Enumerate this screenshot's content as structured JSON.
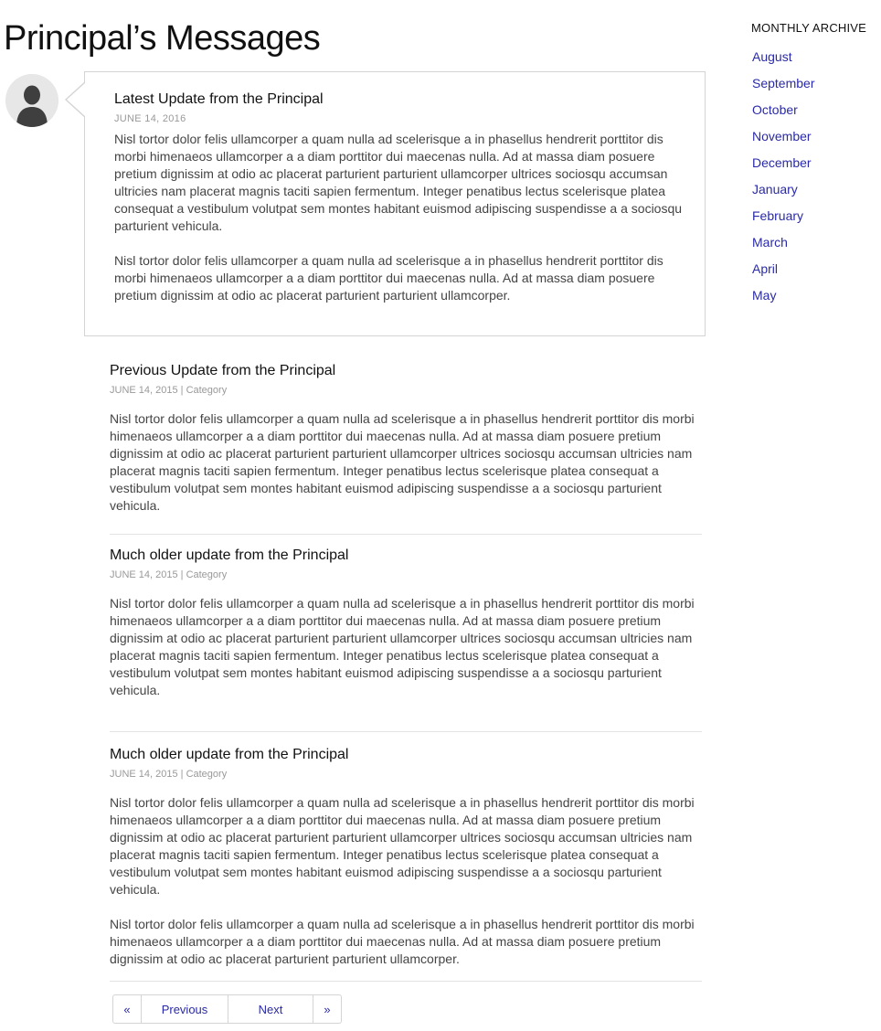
{
  "page": {
    "title": "Principal’s Messages"
  },
  "featured": {
    "title": "Latest Update from the Principal",
    "date": "JUNE 14, 2016",
    "paragraphs": [
      "Nisl tortor dolor felis ullamcorper a quam nulla ad scelerisque a in phasellus hendrerit porttitor dis morbi himenaeos ullamcorper a a diam porttitor dui maecenas nulla. Ad at massa diam posuere pretium dignissim at odio ac placerat parturient parturient ullamcorper ultrices sociosqu accumsan ultricies nam placerat magnis taciti sapien fermentum. Integer penatibus lectus scelerisque platea consequat a vestibulum volutpat sem montes habitant euismod adipiscing suspendisse a a sociosqu parturient vehicula.",
      "Nisl tortor dolor felis ullamcorper a quam nulla ad scelerisque a in phasellus hendrerit porttitor dis morbi himenaeos ullamcorper a a diam porttitor dui maecenas nulla. Ad at massa diam posuere pretium dignissim at odio ac placerat parturient parturient ullamcorper."
    ]
  },
  "posts": [
    {
      "title": "Previous Update from the Principal",
      "meta": "JUNE 14, 2015 | Category",
      "paragraphs": [
        "Nisl tortor dolor felis ullamcorper a quam nulla ad scelerisque a in phasellus hendrerit porttitor dis morbi himenaeos ullamcorper a a diam porttitor dui maecenas nulla. Ad at massa diam posuere pretium dignissim at odio ac placerat parturient parturient ullamcorper ultrices sociosqu accumsan ultricies nam placerat magnis taciti sapien fermentum. Integer penatibus lectus scelerisque platea consequat a vestibulum volutpat sem montes habitant euismod adipiscing suspendisse a a sociosqu parturient vehicula."
      ]
    },
    {
      "title": "Much older update from the Principal",
      "meta": "JUNE 14, 2015 | Category",
      "paragraphs": [
        "Nisl tortor dolor felis ullamcorper a quam nulla ad scelerisque a in phasellus hendrerit porttitor dis morbi himenaeos ullamcorper a a diam porttitor dui maecenas nulla. Ad at massa diam posuere pretium dignissim at odio ac placerat parturient parturient ullamcorper ultrices sociosqu accumsan ultricies nam placerat magnis taciti sapien fermentum. Integer penatibus lectus scelerisque platea consequat a vestibulum volutpat sem montes habitant euismod adipiscing suspendisse a a sociosqu parturient vehicula."
      ]
    },
    {
      "title": "Much older update from the Principal",
      "meta": "JUNE 14, 2015 | Category",
      "paragraphs": [
        "Nisl tortor dolor felis ullamcorper a quam nulla ad scelerisque a in phasellus hendrerit porttitor dis morbi himenaeos ullamcorper a a diam porttitor dui maecenas nulla. Ad at massa diam posuere pretium dignissim at odio ac placerat parturient parturient ullamcorper ultrices sociosqu accumsan ultricies nam placerat magnis taciti sapien fermentum. Integer penatibus lectus scelerisque platea consequat a vestibulum volutpat sem montes habitant euismod adipiscing suspendisse a a sociosqu parturient vehicula.",
        "Nisl tortor dolor felis ullamcorper a quam nulla ad scelerisque a in phasellus hendrerit porttitor dis morbi himenaeos ullamcorper a a diam porttitor dui maecenas nulla. Ad at massa diam posuere pretium dignissim at odio ac placerat parturient parturient ullamcorper."
      ]
    }
  ],
  "pagination": {
    "first": "«",
    "previous": "Previous",
    "next": "Next",
    "last": "»"
  },
  "sidebar": {
    "title": "MONTHLY ARCHIVE",
    "months": [
      "August",
      "September",
      "October",
      "November",
      "December",
      "January",
      "February",
      "March",
      "April",
      "May"
    ]
  },
  "icons": {
    "avatar": "user-silhouette-icon"
  },
  "colors": {
    "link": "#2a2aa8",
    "border": "#d4d4d4",
    "meta": "#999999"
  }
}
